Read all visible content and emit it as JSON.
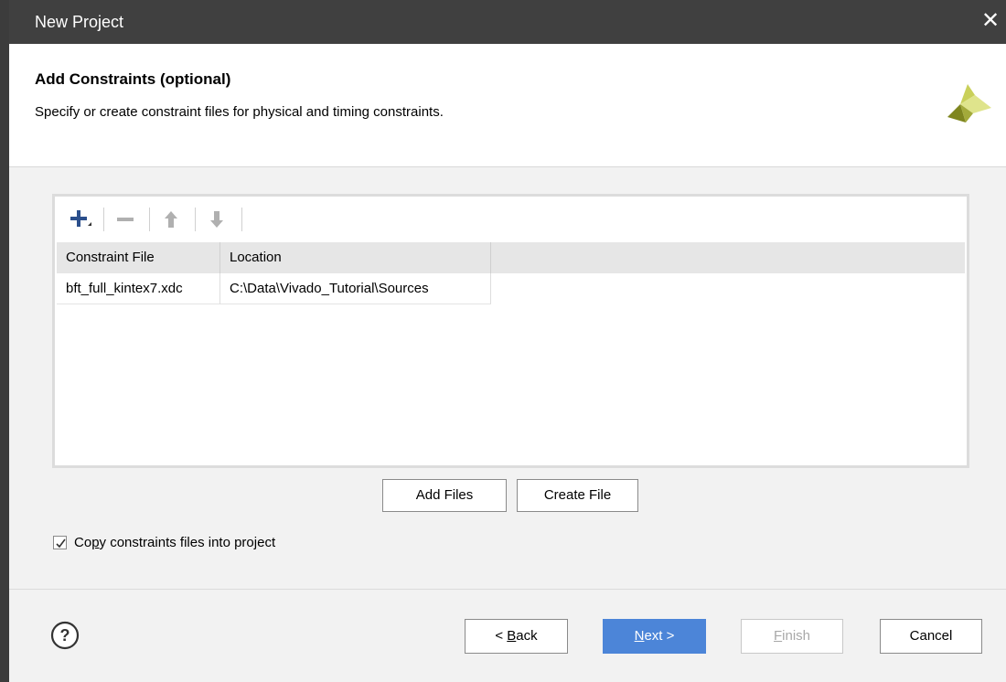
{
  "window": {
    "title": "New Project",
    "close_glyph": "✕"
  },
  "header": {
    "title": "Add Constraints (optional)",
    "subtitle": "Specify or create constraint files for physical and timing constraints.",
    "logo_icon": "xilinx-logo-icon"
  },
  "toolbar": {
    "buttons": [
      {
        "name": "add-icon",
        "enabled": true
      },
      {
        "name": "remove-icon",
        "enabled": false
      },
      {
        "name": "move-up-icon",
        "enabled": false
      },
      {
        "name": "move-down-icon",
        "enabled": false
      }
    ]
  },
  "table": {
    "columns": [
      "Constraint File",
      "Location"
    ],
    "rows": [
      [
        "bft_full_kintex7.xdc",
        "C:\\Data\\Vivado_Tutorial\\Sources"
      ]
    ]
  },
  "file_buttons": {
    "add": "Add Files",
    "create": "Create File"
  },
  "copy_option": {
    "label_pre": "Co",
    "label_accel": "p",
    "label_post": "y constraints files into project",
    "checked": true
  },
  "footer": {
    "back_pre": "< ",
    "back_accel": "B",
    "back_post": "ack",
    "next_accel": "N",
    "next_post": "ext >",
    "finish_accel": "F",
    "finish_post": "inish",
    "cancel": "Cancel",
    "help_glyph": "?"
  },
  "colors": {
    "accent": "#4c85d8",
    "titlebar": "#404040",
    "logo_light": "#d8de7a",
    "logo_dark": "#7f861f"
  }
}
